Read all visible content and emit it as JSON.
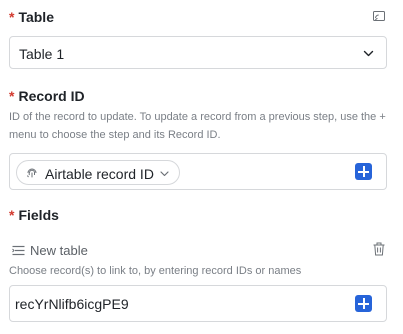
{
  "table": {
    "label": "Table",
    "required_mark": "*",
    "selected_value": "Table 1",
    "icons": {
      "corner": "cast-icon",
      "dropdown": "chevron-down-icon"
    }
  },
  "record_id": {
    "label": "Record ID",
    "required_mark": "*",
    "helper": "ID of the record to update. To update a record from a previous step, use the + menu to choose the step and its Record ID.",
    "pill_label": "Airtable record ID",
    "icons": {
      "pill": "fingerprint-icon",
      "pill_dropdown": "chevron-down-icon",
      "add": "plus-icon"
    }
  },
  "fields": {
    "label": "Fields",
    "required_mark": "*",
    "field_name": "New table",
    "helper": "Choose record(s) to link to, by entering record IDs or names",
    "value": "recYrNlifb6icgPE9",
    "icons": {
      "field": "linked-list-icon",
      "delete": "trash-icon",
      "add": "plus-icon"
    }
  },
  "colors": {
    "accent": "#2764d9",
    "required": "#d23a2f",
    "border": "#d6d8db"
  }
}
